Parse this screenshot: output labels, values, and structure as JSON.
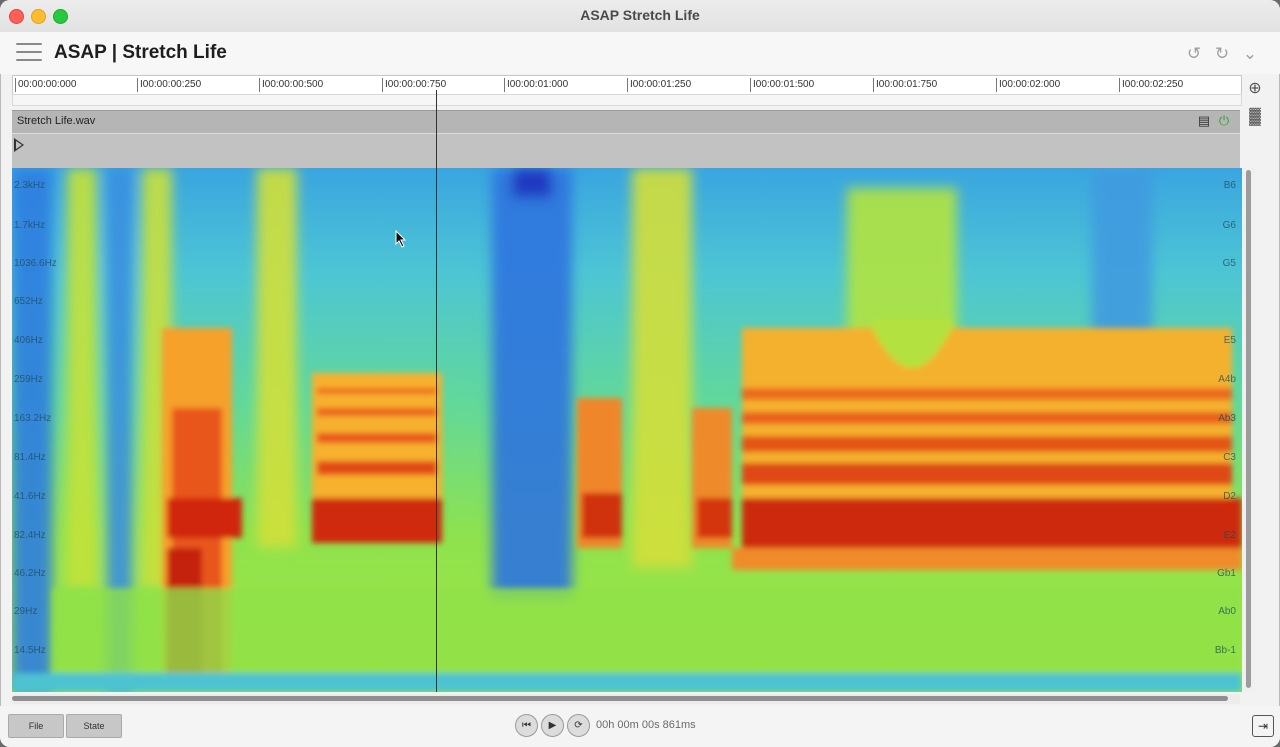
{
  "window": {
    "title": "ASAP Stretch Life"
  },
  "header": {
    "app_title": "ASAP | Stretch Life"
  },
  "timeline": {
    "ticks": [
      "00:00:00:000",
      "I00:00:00:250",
      "I00:00:00:500",
      "I00:00:00:750",
      "I00:00:01:000",
      "I00:00:01:250",
      "I00:00:01:500",
      "I00:00:01:750",
      "I00:00:02:000",
      "I00:00:02:250"
    ]
  },
  "track": {
    "name": "Stretch Life.wav"
  },
  "spectrogram": {
    "freq_labels": [
      "2.3kHz",
      "1.7kHz",
      "1036.6Hz",
      "652Hz",
      "406Hz",
      "259Hz",
      "163.2Hz",
      "81.4Hz",
      "41.6Hz",
      "82.4Hz",
      "46.2Hz",
      "29Hz",
      "14.5Hz"
    ],
    "note_labels": [
      "B6",
      "G6",
      "G5",
      "E5",
      "A4b",
      "Ab3",
      "C3",
      "D2",
      "E2",
      "Gb1",
      "Ab0",
      "Bb-1"
    ]
  },
  "bottom": {
    "file_label": "File",
    "state_label": "State",
    "timecode": "00h 00m 00s 861ms"
  },
  "icons": {
    "hamburger": "menu-icon",
    "undo": "undo-icon",
    "redo": "redo-icon",
    "collapse": "chevron-down-icon",
    "tool1": "target-icon",
    "tool2": "chart-icon",
    "comment": "comment-icon",
    "power": "power-icon",
    "rewind": "rewind-icon",
    "play": "play-icon",
    "loop": "loop-icon",
    "export": "export-icon"
  }
}
